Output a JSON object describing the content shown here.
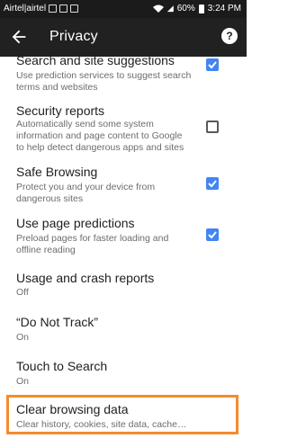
{
  "status_bar": {
    "carrier": "Airtel|airtel",
    "battery": "60%",
    "time": "3:24 PM"
  },
  "toolbar": {
    "title": "Privacy",
    "back_icon": "arrow-back-icon",
    "help_icon": "help-icon"
  },
  "settings": [
    {
      "title": "Search and site suggestions",
      "summary": "Use prediction services to suggest search terms and websites",
      "checked": true
    },
    {
      "title": "Security reports",
      "summary": "Automatically send some system information and page content to Google to help detect dangerous apps and sites",
      "checked": false
    },
    {
      "title": "Safe Browsing",
      "summary": "Protect you and your device from dangerous sites",
      "checked": true
    },
    {
      "title": "Use page predictions",
      "summary": "Preload pages for faster loading and offline reading",
      "checked": true
    },
    {
      "title": "Usage and crash reports",
      "summary": "Off"
    },
    {
      "title": "“Do Not Track”",
      "summary": "On"
    },
    {
      "title": "Touch to Search",
      "summary": "On"
    },
    {
      "title": "Clear browsing data",
      "summary": "Clear history, cookies, site data, cache…"
    }
  ],
  "colors": {
    "toolbar": "#212121",
    "status_bar": "#1b1b1b",
    "checkbox_on": "#4285f4",
    "highlight": "#f68b2e"
  }
}
